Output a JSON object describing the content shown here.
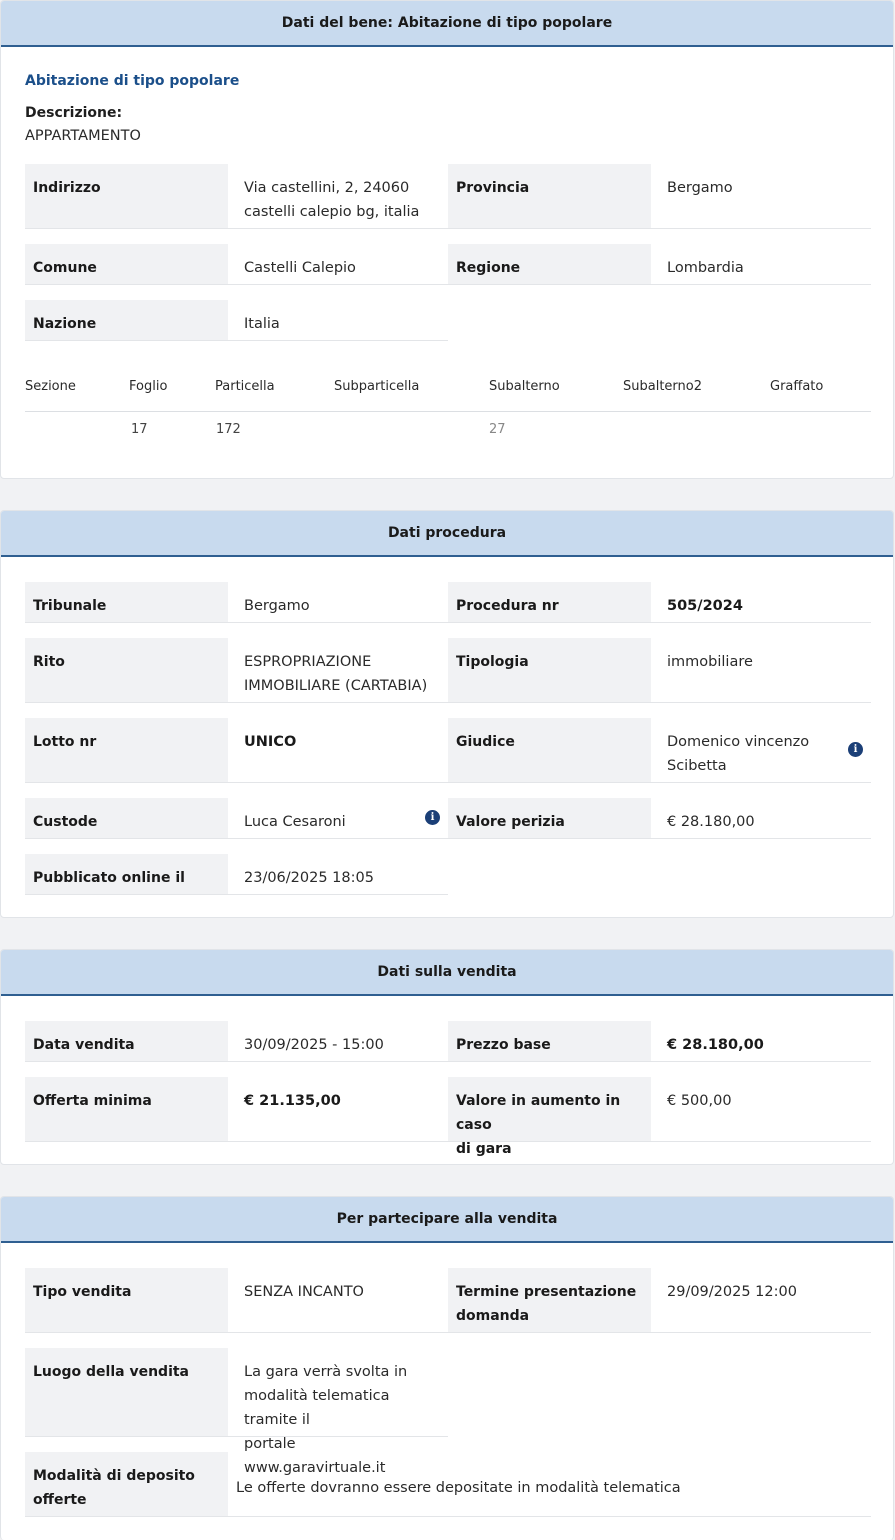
{
  "bene": {
    "header": "Dati del bene: Abitazione di tipo popolare",
    "subtitle": "Abitazione di tipo popolare",
    "descrizione_label": "Descrizione:",
    "descrizione_value": "APPARTAMENTO",
    "fields": {
      "indirizzo_label": "Indirizzo",
      "indirizzo_value_line1": "Via castellini, 2, 24060",
      "indirizzo_value_line2": "castelli calepio bg, italia",
      "provincia_label": "Provincia",
      "provincia_value": "Bergamo",
      "comune_label": "Comune",
      "comune_value": "Castelli Calepio",
      "regione_label": "Regione",
      "regione_value": "Lombardia",
      "nazione_label": "Nazione",
      "nazione_value": "Italia"
    },
    "catasto": {
      "headers": [
        "Sezione",
        "Foglio",
        "Particella",
        "Subparticella",
        "Subalterno",
        "Subalterno2",
        "Graffato"
      ],
      "row": [
        "",
        "17",
        "172",
        "",
        "27",
        "",
        ""
      ]
    }
  },
  "procedura": {
    "header": "Dati procedura",
    "tribunale_label": "Tribunale",
    "tribunale_value": "Bergamo",
    "procedura_label": "Procedura nr",
    "procedura_value": "505/2024",
    "rito_label": "Rito",
    "rito_value_line1": "ESPROPRIAZIONE",
    "rito_value_line2": "IMMOBILIARE (CARTABIA)",
    "tipologia_label": "Tipologia",
    "tipologia_value": "immobiliare",
    "lotto_label": "Lotto nr",
    "lotto_value": "UNICO",
    "giudice_label": "Giudice",
    "giudice_value_line1": "Domenico vincenzo",
    "giudice_value_line2": "Scibetta",
    "custode_label": "Custode",
    "custode_value": "Luca Cesaroni",
    "perizia_label": "Valore perizia",
    "perizia_value": "€ 28.180,00",
    "pubblicato_label": "Pubblicato online il",
    "pubblicato_value": "23/06/2025 18:05",
    "info_glyph": "i"
  },
  "vendita": {
    "header": "Dati sulla vendita",
    "data_label": "Data vendita",
    "data_value": "30/09/2025 - 15:00",
    "prezzo_label": "Prezzo base",
    "prezzo_value": "€ 28.180,00",
    "offerta_label": "Offerta minima",
    "offerta_value": "€ 21.135,00",
    "aumento_label_line1": "Valore in aumento in caso",
    "aumento_label_line2": "di gara",
    "aumento_value": "€ 500,00"
  },
  "partecipare": {
    "header": "Per partecipare alla vendita",
    "tipo_label": "Tipo vendita",
    "tipo_value": "SENZA INCANTO",
    "termine_label_line1": "Termine presentazione",
    "termine_label_line2": "domanda",
    "termine_value": "29/09/2025 12:00",
    "luogo_label": "Luogo della vendita",
    "luogo_value_line1": "La gara verrà svolta in",
    "luogo_value_line2": "modalità telematica tramite il",
    "luogo_value_line3": "portale www.garavirtuale.it",
    "modalita_label_line1": "Modalità di deposito",
    "modalita_label_line2": "offerte",
    "modalita_value": "Le offerte dovranno essere depositate in modalità telematica"
  }
}
